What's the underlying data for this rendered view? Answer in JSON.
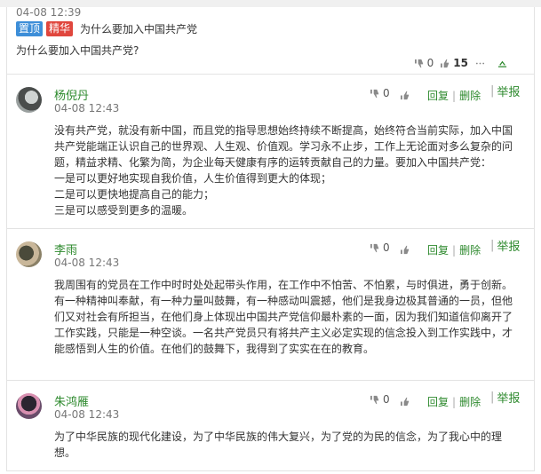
{
  "post": {
    "time": "04-08 12:39",
    "badge_top": "置顶",
    "badge_fine": "精华",
    "title": "为什么要加入中国共产党",
    "body": "为什么要加入中国共产党?",
    "down_count": "0",
    "like_count": "15",
    "colors": {
      "badge_top": "#3d8ed8",
      "badge_fine": "#e0463d",
      "link": "#2e8a2e"
    }
  },
  "comments": [
    {
      "name": "杨倪丹",
      "time": "04-08 12:43",
      "vote": "0",
      "reply": "回复",
      "delete": "删除",
      "report": "举报",
      "lines": [
        "没有共产党，就没有新中国，而且党的指导思想始终持续不断提高，始终符合当前实际，加入中国共产党能端正认识自己的世界观、人生观、价值观。学习永不止步，工作上无论面对多么复杂的问题，精益求精、化繁为简，为企业每天健康有序的运转贡献自己的力量。要加入中国共产党：",
        "一是可以更好地实现自我价值，人生价值得到更大的体现；",
        "二是可以更快地提高自己的能力；",
        "三是可以感受到更多的温暖。"
      ]
    },
    {
      "name": "李雨",
      "time": "04-08 12:43",
      "vote": "0",
      "reply": "回复",
      "delete": "删除",
      "report": "举报",
      "lines": [
        "我周围有的党员在工作中时时处处起带头作用，在工作中不怕苦、不怕累，与时俱进，勇于创新。有一种精神叫奉献，有一种力量叫鼓舞，有一种感动叫震撼，他们是我身边极其普通的一员，但他们又对社会有所担当，在他们身上体现出中国共产党信仰最朴素的一面，因为我们知道信仰离开了工作实践，只能是一种空谈。一名共产党员只有将共产主义必定实现的信念投入到工作实践中，才能感悟到人生的价值。在他们的鼓舞下，我得到了实实在在的教育。"
      ]
    },
    {
      "name": "朱鸿雁",
      "time": "04-08 12:43",
      "vote": "0",
      "reply": "回复",
      "delete": "删除",
      "report": "举报",
      "lines": [
        "为了中华民族的现代化建设，为了中华民族的伟大复兴，为了党的为民的信念，为了我心中的理想。"
      ]
    }
  ]
}
